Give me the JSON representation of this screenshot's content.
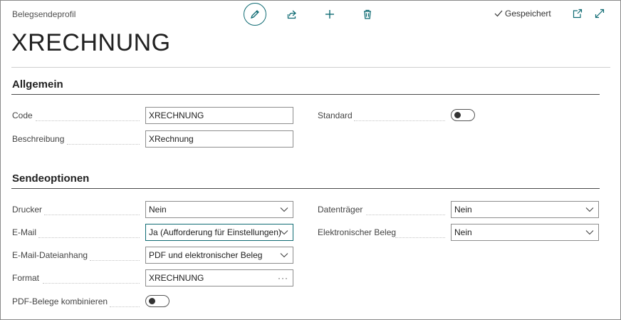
{
  "header": {
    "breadcrumb": "Belegsendeprofil",
    "saved_status": "Gespeichert",
    "page_title": "XRECHNUNG"
  },
  "colors": {
    "accent": "#0f6b73",
    "border": "#8d8d8d",
    "section_rule": "#4a4a4a"
  },
  "icons": [
    "pencil-icon",
    "share-icon",
    "plus-icon",
    "trash-icon",
    "checkmark-icon",
    "popout-icon",
    "expand-icon",
    "chevron-down-icon",
    "ellipsis-icon"
  ],
  "sections": {
    "general": {
      "title": "Allgemein",
      "code_label": "Code",
      "code_value": "XRECHNUNG",
      "description_label": "Beschreibung",
      "description_value": "XRechnung",
      "default_label": "Standard",
      "default_value": false
    },
    "send_options": {
      "title": "Sendeoptionen",
      "printer_label": "Drucker",
      "printer_value": "Nein",
      "email_label": "E-Mail",
      "email_value": "Ja (Aufforderung für Einstellungen)",
      "email_attachment_label": "E-Mail-Dateianhang",
      "email_attachment_value": "PDF und elektronischer Beleg",
      "format_label": "Format",
      "format_value": "XRECHNUNG",
      "combine_pdf_label": "PDF-Belege kombinieren",
      "combine_pdf_value": false,
      "disk_label": "Datenträger",
      "disk_value": "Nein",
      "electronic_doc_label": "Elektronischer Beleg",
      "electronic_doc_value": "Nein"
    }
  }
}
